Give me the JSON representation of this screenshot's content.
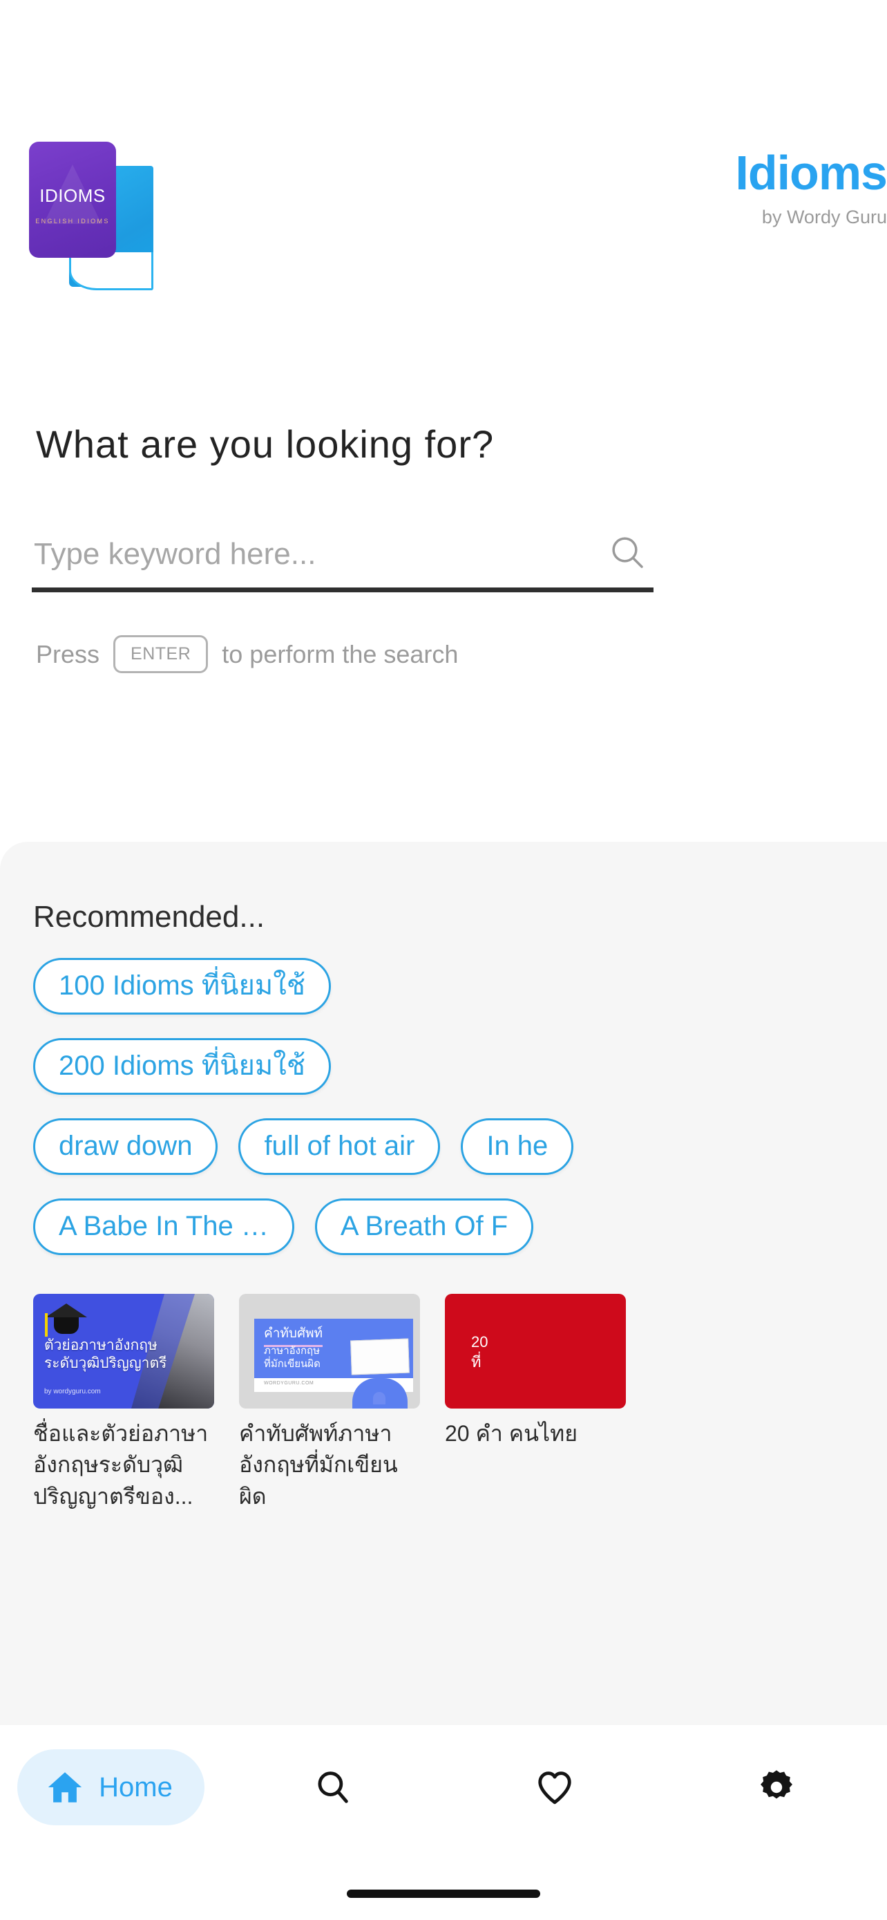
{
  "brand": {
    "title": "Idioms",
    "subtitle": "by Wordy Guru",
    "logo_word": "IDIOMS",
    "logo_sub": "ENGLISH IDIOMS"
  },
  "colors": {
    "accent_blue": "#29A3F0",
    "chip_blue": "#2BA3E3",
    "panel_bg": "#F6F6F6",
    "nav_active_bg": "#E3F2FD",
    "logo_purple": "#6B33BE",
    "underline": "#2F2F2F"
  },
  "search": {
    "heading": "What are you looking for?",
    "placeholder": "Type keyword here...",
    "value": "",
    "hint_before": "Press",
    "enter_key": "ENTER",
    "hint_after": "to perform the search"
  },
  "recommended": {
    "title": "Recommended...",
    "rows": [
      [
        "100 Idioms ที่นิยมใช้"
      ],
      [
        "200 Idioms ที่นิยมใช้"
      ],
      [
        "draw down",
        "full of hot air",
        "In he"
      ],
      [
        "A Babe In The …",
        "A Breath Of F"
      ]
    ]
  },
  "cards": [
    {
      "caption": "ชื่อและตัวย่อภาษาอังกฤษระดับวุฒิปริญญาตรีของ...",
      "thumb_line1": "ตัวย่อภาษาอังกฤษ",
      "thumb_line2": "ระดับวุฒิปริญญาตรี",
      "thumb_credit": "by wordyguru.com"
    },
    {
      "caption": "คำทับศัพท์ภาษาอังกฤษที่มักเขียนผิด",
      "thumb_line1": "คำทับศัพท์",
      "thumb_line2": "ภาษาอังกฤษ",
      "thumb_line3": "ที่มักเขียนผิด",
      "thumb_credit": "WORDYGURU.COM"
    },
    {
      "caption": "20 คำ คนไทย",
      "thumb_line1": "20",
      "thumb_line2": "ที่"
    }
  ],
  "bottom_nav": {
    "items": [
      {
        "label": "Home",
        "icon": "home-icon",
        "active": true
      },
      {
        "label": "",
        "icon": "search-icon",
        "active": false
      },
      {
        "label": "",
        "icon": "heart-icon",
        "active": false
      },
      {
        "label": "",
        "icon": "gear-icon",
        "active": false
      }
    ]
  }
}
